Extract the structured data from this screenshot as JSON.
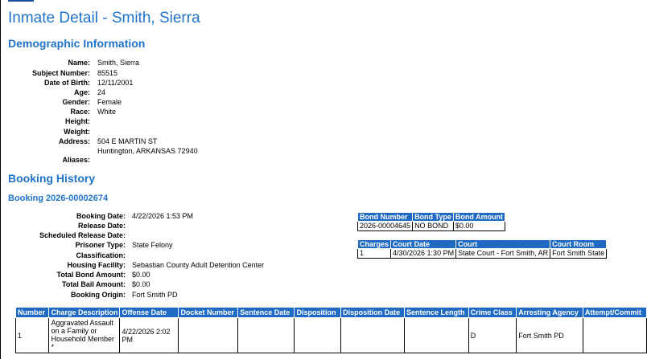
{
  "page": {
    "title": "Inmate Detail - Smith, Sierra"
  },
  "demographic": {
    "heading": "Demographic Information",
    "fields": [
      {
        "label": "Name:",
        "value": "Smith, Sierra"
      },
      {
        "label": "Subject Number:",
        "value": "85515"
      },
      {
        "label": "Date of Birth:",
        "value": "12/11/2001"
      },
      {
        "label": "Age:",
        "value": "24"
      },
      {
        "label": "Gender:",
        "value": "Female"
      },
      {
        "label": "Race:",
        "value": "White"
      },
      {
        "label": "Height:",
        "value": ""
      },
      {
        "label": "Weight:",
        "value": ""
      },
      {
        "label": "Address:",
        "value": "504 E MARTIN ST",
        "value2": "Huntington, ARKANSAS 72940"
      },
      {
        "label": "Aliases:",
        "value": ""
      }
    ]
  },
  "booking_history": {
    "heading": "Booking History",
    "booking_title": "Booking 2026-00002674",
    "fields": [
      {
        "label": "Booking Date:",
        "value": "4/22/2026 1:53 PM"
      },
      {
        "label": "Release Date:",
        "value": ""
      },
      {
        "label": "Scheduled Release Date:",
        "value": ""
      },
      {
        "label": "Prisoner Type:",
        "value": "State Felony"
      },
      {
        "label": "Classification:",
        "value": ""
      },
      {
        "label": "Housing Facility:",
        "value": "Sebastian County Adult Detention Center"
      },
      {
        "label": "Total Bond Amount:",
        "value": "$0.00"
      },
      {
        "label": "Total Bail Amount:",
        "value": "$0.00"
      },
      {
        "label": "Booking Origin:",
        "value": "Fort Smith PD"
      }
    ],
    "bond_table": {
      "headers": [
        "Bond Number",
        "Bond Type",
        "Bond Amount"
      ],
      "rows": [
        [
          "2026-00004645",
          "NO BOND",
          "$0.00"
        ]
      ]
    },
    "court_table": {
      "headers": [
        "Charges",
        "Court Date",
        "Court",
        "Court Room"
      ],
      "rows": [
        [
          "1",
          "4/30/2026 1:30 PM",
          "State Court - Fort Smith, AR",
          "Fort Smith State"
        ]
      ]
    },
    "charges_table": {
      "headers": [
        "Number",
        "Charge Description",
        "Offense Date",
        "Docket Number",
        "Sentence Date",
        "Disposition",
        "Disposition Date",
        "Sentence Length",
        "Crime Class",
        "Arresting Agency",
        "Attempt/Commit"
      ],
      "rows": [
        {
          "number": "1",
          "description_lines": [
            "Aggravated Assault",
            "on a Family or",
            "Household Member",
            "*"
          ],
          "offense_date": "4/22/2026 2:02 PM",
          "docket_number": "",
          "sentence_date": "",
          "disposition": "",
          "disposition_date": "",
          "sentence_length": "",
          "crime_class": "D",
          "arresting_agency": "Fort Smith PD",
          "attempt_commit": ""
        }
      ]
    }
  },
  "colors": {
    "heading": "#1f73c9",
    "table_header_bg": "#1f6bc4"
  }
}
